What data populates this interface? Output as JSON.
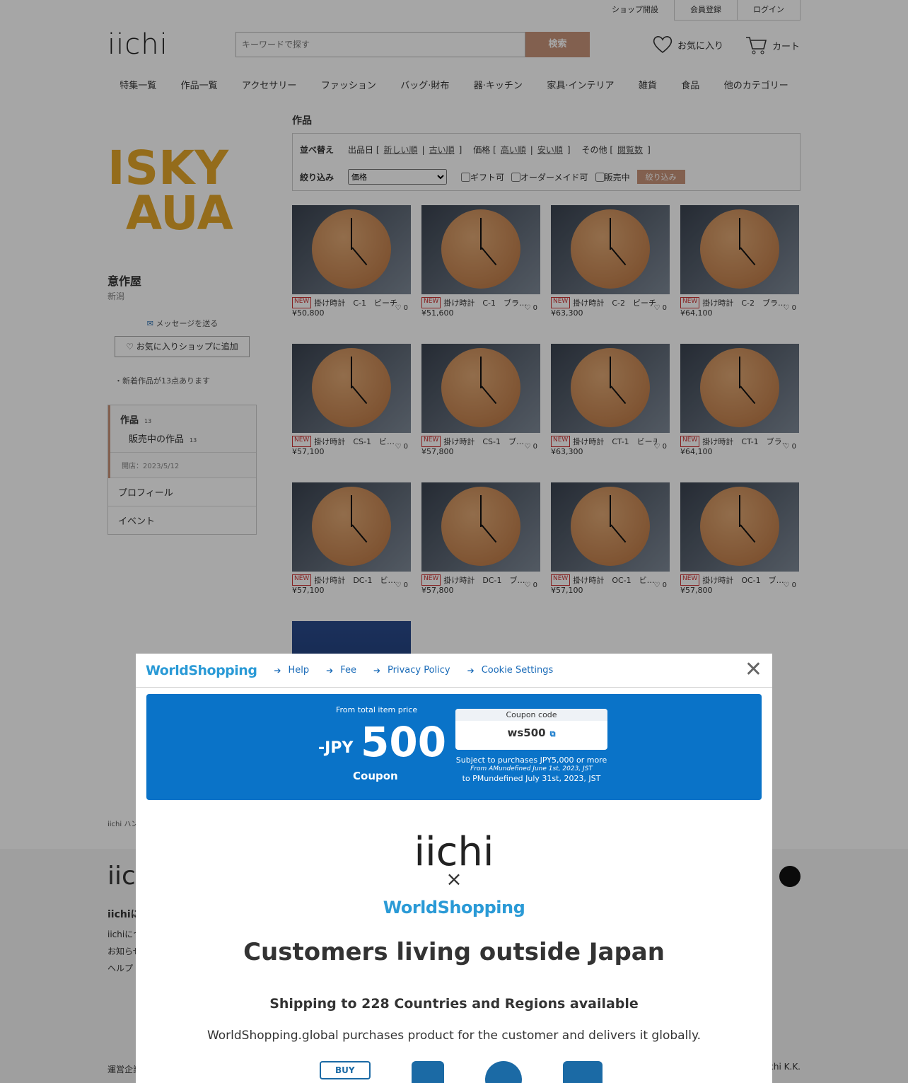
{
  "topbar": {
    "open_shop": "ショップ開設",
    "register": "会員登録",
    "login": "ログイン"
  },
  "header": {
    "logo": "iichi",
    "search_placeholder": "キーワードで探す",
    "search_button": "検索",
    "favorites": "お気に入り",
    "cart": "カート"
  },
  "gnav": [
    "特集一覧",
    "作品一覧",
    "アクセサリー",
    "ファッション",
    "バッグ·財布",
    "器·キッチン",
    "家具·インテリア",
    "雑貨",
    "食品",
    "他のカテゴリー"
  ],
  "shop": {
    "logo_text_1": "ISKY",
    "logo_text_2": "AUA",
    "name": "意作屋",
    "location": "新潟",
    "message": "メッセージを送る",
    "add_favorite": "お気に入りショップに追加",
    "new_note": "・新着作品が13点あります",
    "menu": {
      "works": "作品",
      "works_count": "13",
      "on_sale": "販売中の作品",
      "on_sale_count": "13",
      "opened": "開店：2023/5/12",
      "profile": "プロフィール",
      "event": "イベント"
    }
  },
  "section_title": "作品",
  "filter": {
    "sort_label": "並べ替え",
    "date_label": "出品日 [",
    "newest": "新しい順",
    "oldest": "古い順",
    "price_label": "価格 [",
    "high": "高い順",
    "low": "安い順",
    "other_label": "その他 [",
    "views": "閲覧数",
    "close_bracket": "]",
    "narrow_label": "絞り込み",
    "price_select": "価格",
    "gift": "ギフト可",
    "order": "オーダーメイド可",
    "selling": "販売中",
    "apply": "絞り込み"
  },
  "products": [
    {
      "name": "掛け時計　C-1　ビーチ",
      "price": "¥50,800",
      "likes": "0"
    },
    {
      "name": "掛け時計　C-1　ブラ…",
      "price": "¥51,600",
      "likes": "0"
    },
    {
      "name": "掛け時計　C-2　ビーチ",
      "price": "¥63,300",
      "likes": "0"
    },
    {
      "name": "掛け時計　C-2　ブラ…",
      "price": "¥64,100",
      "likes": "0"
    },
    {
      "name": "掛け時計　CS-1　ビ…",
      "price": "¥57,100",
      "likes": "0"
    },
    {
      "name": "掛け時計　CS-1　ブ…",
      "price": "¥57,800",
      "likes": "0"
    },
    {
      "name": "掛け時計　CT-1　ビーチ",
      "price": "¥63,300",
      "likes": "0"
    },
    {
      "name": "掛け時計　CT-1　ブラ…",
      "price": "¥64,100",
      "likes": "0"
    },
    {
      "name": "掛け時計　DC-1　ビ…",
      "price": "¥57,100",
      "likes": "0"
    },
    {
      "name": "掛け時計　DC-1　ブ…",
      "price": "¥57,800",
      "likes": "0"
    },
    {
      "name": "掛け時計　OC-1　ビ…",
      "price": "¥57,100",
      "likes": "0"
    },
    {
      "name": "掛け時計　OC-1　ブ…",
      "price": "¥57,800",
      "likes": "0"
    }
  ],
  "new_badge": "NEW",
  "modal": {
    "brand": "WorldShopping",
    "links": [
      "Help",
      "Fee",
      "Privacy Policy",
      "Cookie Settings"
    ],
    "coupon_from": "From total item price",
    "coupon_prefix": "-JPY",
    "coupon_amount": "500",
    "coupon_label": "Coupon",
    "code_title": "Coupon code",
    "code": "ws500",
    "subject": "Subject to purchases JPY5,000 or more",
    "from_date": "From AMundefined June 1st, 2023, JST",
    "to_date": "to PMundefined July 31st, 2023, JST",
    "iichi": "iichi",
    "times": "×",
    "headline": "Customers living outside Japan",
    "shipping": "Shipping to 228 Countries and Regions available",
    "desc": "WorldShopping.global purchases product for the customer and delivers it globally.",
    "buy": "BUY"
  },
  "footer": {
    "crumb": "iichi ハン",
    "logo": "iic",
    "about": "iichiに",
    "l1": "iichiにつ",
    "l2": "お知らせ",
    "l3": "ヘルプ",
    "company": "運営企業",
    "copyright": "iichi K.K."
  }
}
